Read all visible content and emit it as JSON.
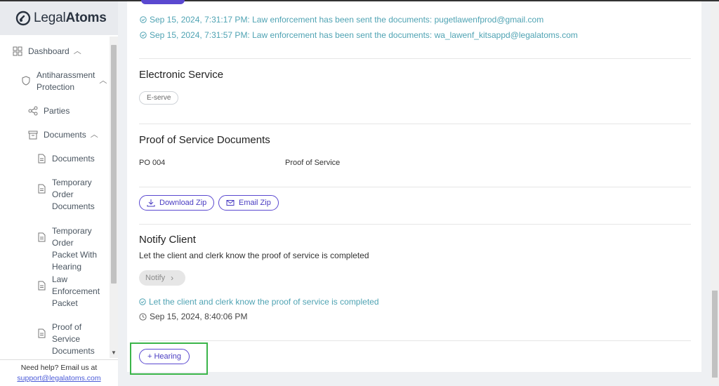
{
  "brand": {
    "name_light": "Legal",
    "name_bold": "Atoms"
  },
  "sidebar": {
    "items": [
      {
        "label": "Dashboard",
        "icon": "grid-icon",
        "chevron": "up"
      },
      {
        "label": "Antiharassment Protection",
        "icon": "shield-icon",
        "chevron": "up"
      },
      {
        "label": "Parties",
        "icon": "share-icon"
      },
      {
        "label": "Documents",
        "icon": "archive-icon",
        "chevron": "up"
      },
      {
        "label": "Documents",
        "icon": "file-icon"
      },
      {
        "label": "Temporary Order Documents",
        "icon": "file-icon"
      },
      {
        "label": "Temporary Order Packet With Hearing",
        "icon": "file-icon"
      },
      {
        "label": "Law Enforcement Packet",
        "icon": "file-icon"
      },
      {
        "label": "Proof of Service Documents",
        "icon": "file-icon"
      }
    ],
    "help_text": "Need help? Email us at",
    "help_email": "support@legalatoms.com"
  },
  "activity": [
    "Sep 15, 2024, 7:31:17 PM: Law enforcement has been sent the documents: pugetlawenfprod@gmail.com",
    "Sep 15, 2024, 7:31:57 PM: Law enforcement has been sent the documents: wa_lawenf_kitsappd@legalatoms.com"
  ],
  "electronic_service": {
    "title": "Electronic Service",
    "chip": "E-serve"
  },
  "proof_of_service": {
    "title": "Proof of Service Documents",
    "rows": [
      {
        "code": "PO 004",
        "name": "Proof of Service"
      }
    ],
    "download_label": "Download Zip",
    "email_label": "Email Zip"
  },
  "notify_client": {
    "title": "Notify Client",
    "description": "Let the client and clerk know the proof of service is completed",
    "button_label": "Notify",
    "status": "Let the client and clerk know the proof of service is completed",
    "timestamp": "Sep 15, 2024, 8:40:06 PM"
  },
  "hearing_button": "+ Hearing",
  "colors": {
    "accent": "#5a48d0",
    "link_teal": "#4fa3b3",
    "highlight": "#3bb54a"
  }
}
